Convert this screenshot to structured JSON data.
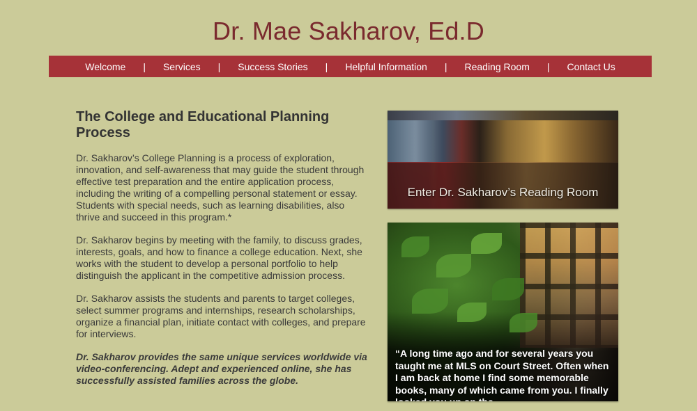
{
  "site": {
    "title": "Dr. Mae Sakharov, Ed.D"
  },
  "nav": {
    "items": [
      {
        "label": "Welcome"
      },
      {
        "label": "Services"
      },
      {
        "label": "Success Stories"
      },
      {
        "label": "Helpful Information"
      },
      {
        "label": "Reading Room"
      },
      {
        "label": "Contact Us"
      }
    ],
    "separator": "|"
  },
  "main": {
    "heading": "The College and Educational Planning Process",
    "paragraphs": [
      "Dr. Sakharov’s College Planning is a process of exploration, innovation, and self-awareness that may guide the student through effective test preparation and the entire application process, including the writing of a compelling personal statement or essay. Students with special needs, such as learning disabilities, also thrive and succeed in this program.*",
      "Dr. Sakharov begins by meeting with the family,  to discuss grades, interests, goals, and how to finance a college education. Next, she works with the student to develop a personal portfolio to help distinguish the applicant in the competitive admission process.",
      "Dr. Sakharov assists the students and parents to target colleges, select summer programs and internships, research scholarships, organize a financial plan, initiate contact with colleges, and prepare for interviews.",
      "Dr. Sakharov provides the same unique services worldwide via video-conferencing. Adept and experienced online, she has successfully assisted families across the globe."
    ]
  },
  "sidebar": {
    "reading_room_caption": "Enter Dr. Sakharov’s Reading Room",
    "testimonial": "“A long time ago and for several years you taught me at MLS on Court Street. Often when I am back at home I find some memorable books, many of which came from you. I finally looked you up on the"
  },
  "colors": {
    "background": "#cbcb99",
    "title": "#7a2a2e",
    "nav_bar": "#a63238",
    "nav_text": "#ffffff",
    "body_text": "#333333"
  }
}
